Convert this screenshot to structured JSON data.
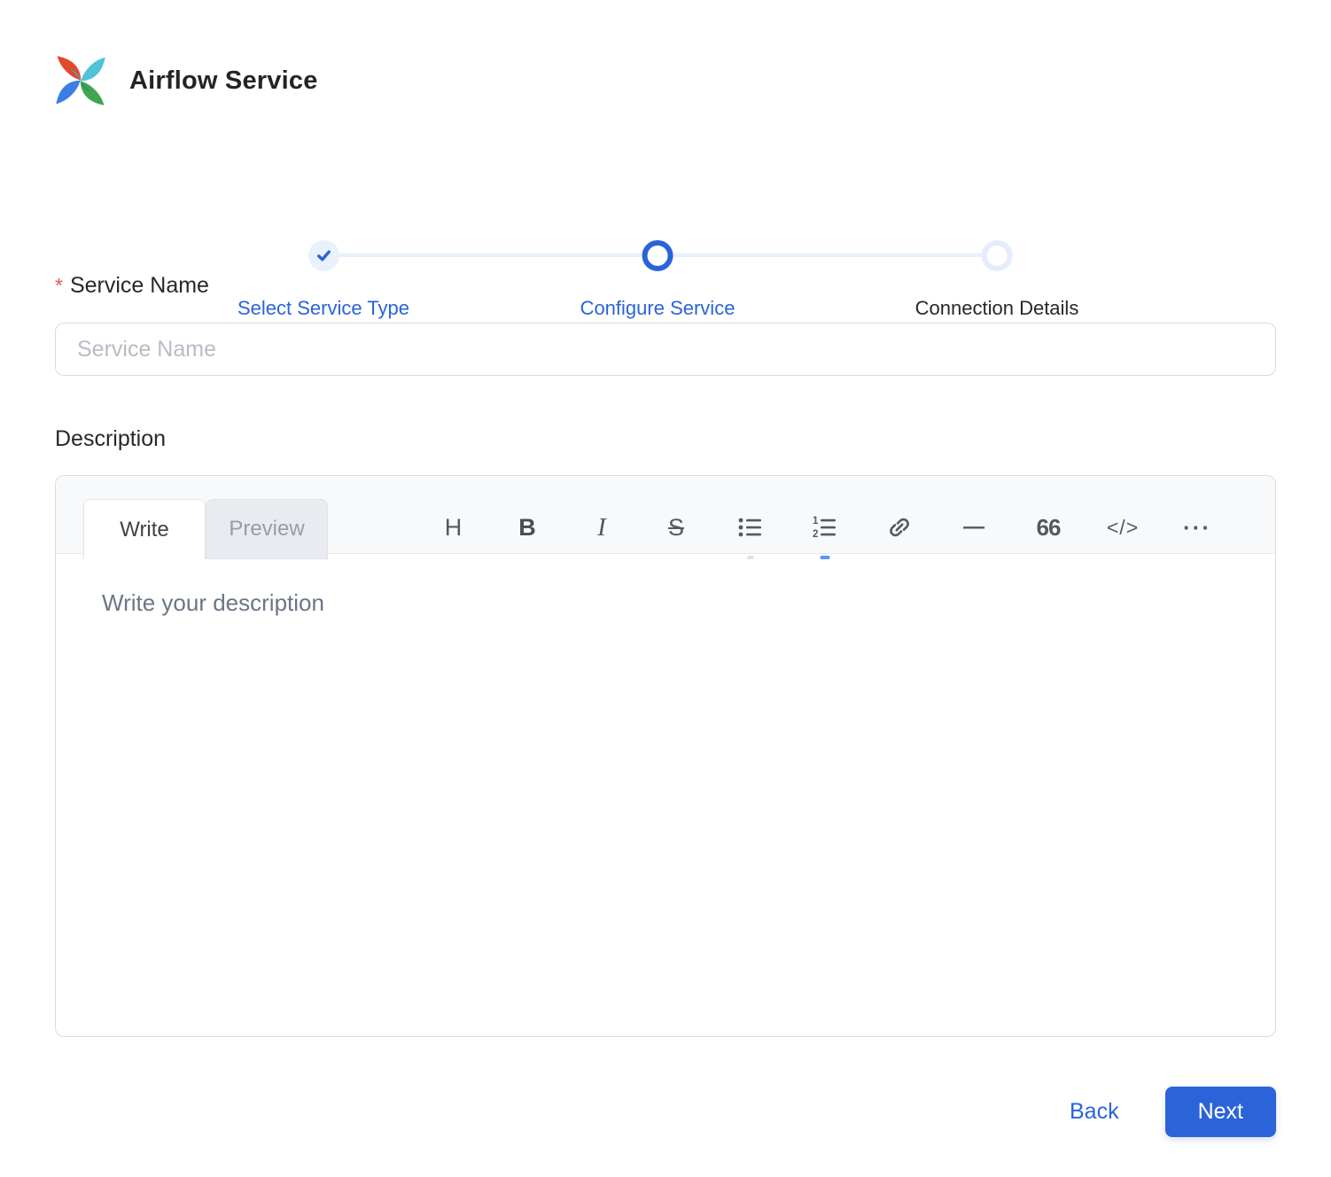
{
  "header": {
    "title": "Airflow Service",
    "logo": "airflow-pinwheel"
  },
  "stepper": {
    "steps": [
      {
        "label": "Select Service Type",
        "state": "completed"
      },
      {
        "label": "Configure Service",
        "state": "active"
      },
      {
        "label": "Connection Details",
        "state": "pending"
      }
    ]
  },
  "form": {
    "service_name": {
      "label": "Service Name",
      "required_marker": "*",
      "placeholder": "Service Name",
      "value": ""
    },
    "description": {
      "label": "Description",
      "editor": {
        "tabs": [
          {
            "label": "Write",
            "active": true
          },
          {
            "label": "Preview",
            "active": false
          }
        ],
        "toolbar": [
          {
            "name": "heading",
            "glyph": "H"
          },
          {
            "name": "bold",
            "glyph": "B"
          },
          {
            "name": "italic",
            "glyph": "I"
          },
          {
            "name": "strikethrough",
            "glyph": "S"
          },
          {
            "name": "unordered-list"
          },
          {
            "name": "ordered-list"
          },
          {
            "name": "link"
          },
          {
            "name": "horizontal-rule",
            "glyph": "—"
          },
          {
            "name": "quote",
            "glyph": "66"
          },
          {
            "name": "code",
            "glyph": "</>"
          },
          {
            "name": "more",
            "glyph": "···"
          }
        ],
        "placeholder": "Write your description",
        "value": ""
      }
    }
  },
  "footer": {
    "back_label": "Back",
    "next_label": "Next"
  },
  "colors": {
    "primary_blue": "#2b63d9",
    "step_done_fill": "#e8f1fc",
    "step_pending_ring": "#e3edfb",
    "required_red": "#ef5350",
    "border_gray": "#d8dce2",
    "editor_header_bg": "#f8f9fb",
    "next_button_bg": "#2b63d9",
    "logo_red": "#e0492e",
    "logo_teal": "#4ec3d9",
    "logo_green": "#3ea550",
    "logo_blue": "#3b7de3"
  }
}
